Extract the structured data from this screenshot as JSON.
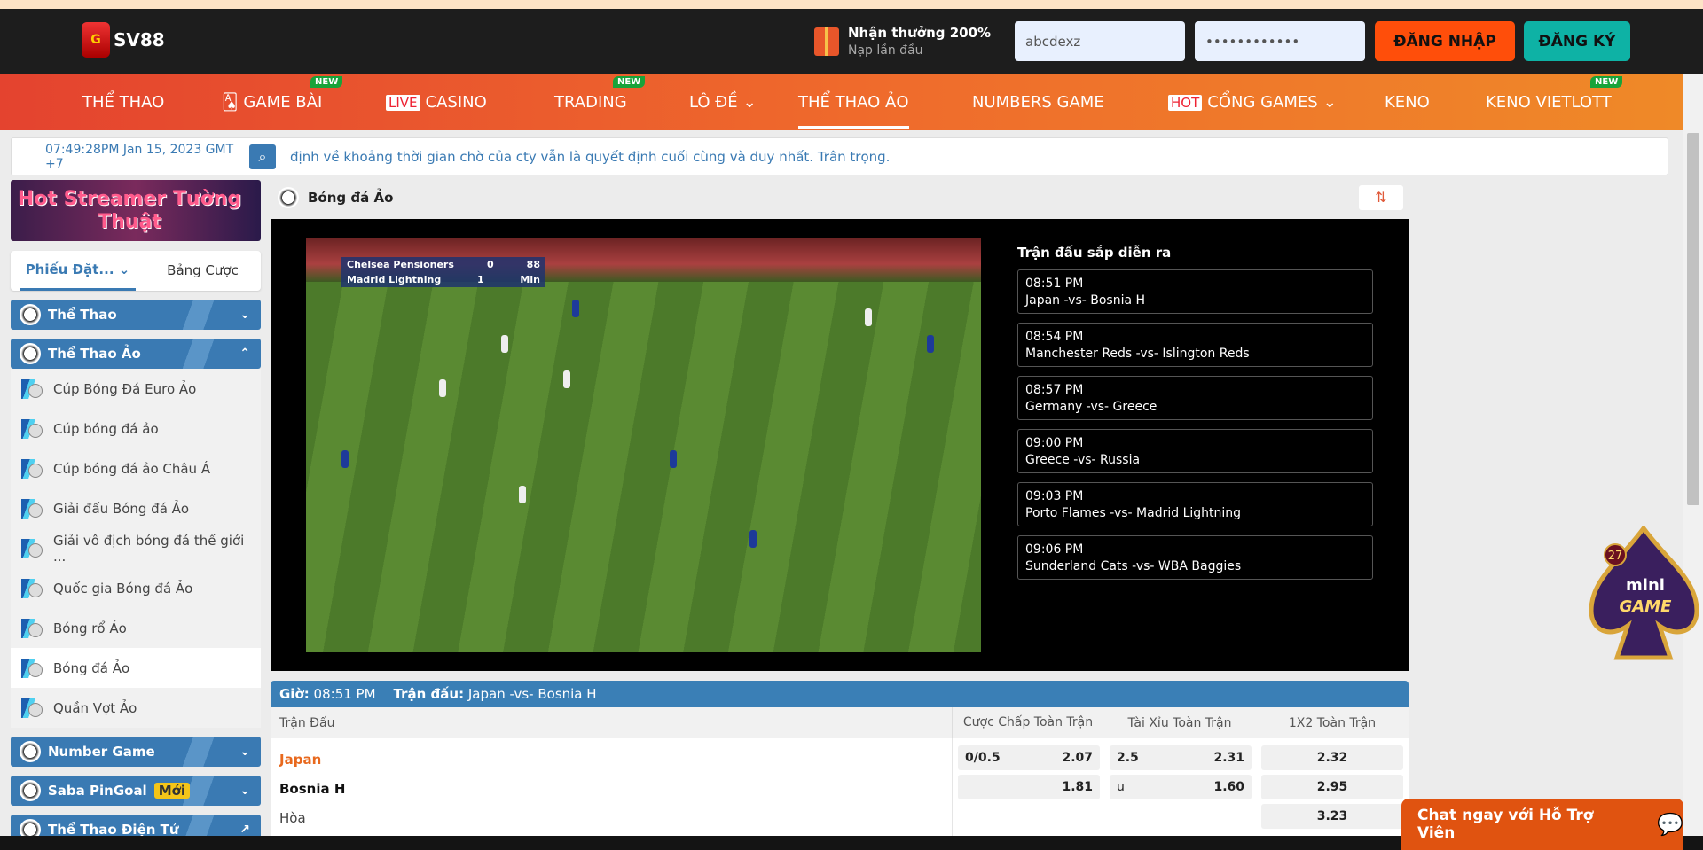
{
  "header": {
    "logo_text": "SV88",
    "promo_title": "Nhận thưởng 200%",
    "promo_sub": "Nạp lần đầu",
    "username_value": "abcdexz",
    "password_value": "••••••••••••",
    "login_label": "ĐĂNG NHẬP",
    "register_label": "ĐĂNG KÝ",
    "colors": {
      "login": "#ff4e0a",
      "register": "#0eb2a5"
    }
  },
  "nav": {
    "items": [
      {
        "label": "THỂ THAO"
      },
      {
        "label": "GAME BÀI",
        "new": "NEW"
      },
      {
        "label": "CASINO",
        "badge": "LIVE"
      },
      {
        "label": "TRADING",
        "new": "NEW"
      },
      {
        "label": "LÔ ĐỀ"
      },
      {
        "label": "THỂ THAO ẢO"
      },
      {
        "label": "NUMBERS GAME"
      },
      {
        "label": "CỔNG GAMES",
        "badge": "HOT"
      },
      {
        "label": "KENO"
      },
      {
        "label": "KENO VIETLOTT",
        "new": "NEW"
      }
    ]
  },
  "marquee": {
    "datetime": "07:49:28PM Jan 15, 2023 GMT +7",
    "message": "định về khoảng thời gian chờ của cty vẫn là quyết định cuối cùng và duy nhất. Trân trọng."
  },
  "sidebar": {
    "banner_text": "Hot Streamer Tường Thuật",
    "tabs": [
      "Phiếu Đặt...",
      "Bảng Cược"
    ],
    "sections": [
      "Thể Thao",
      "Thể Thao Ảo",
      "Number Game",
      "Saba PinGoal",
      "Thể Thao Điện Tử"
    ],
    "saba_badge": "Mới",
    "items": [
      "Cúp Bóng Đá Euro Ảo",
      "Cúp bóng đá ảo",
      "Cúp bóng đá ảo Châu Á",
      "Giải đấu Bóng đá Ảo",
      "Giải vô địch bóng đá thế giới ...",
      "Quốc gia Bóng đá Ảo",
      "Bóng rổ Ảo",
      "Bóng đá Ảo",
      "Quần Vợt Ảo"
    ]
  },
  "main": {
    "title": "Bóng đá Ảo",
    "video": {
      "home": "Chelsea Pensioners",
      "away": "Madrid Lightning",
      "home_score": "0",
      "away_score": "1",
      "clock": "88",
      "clock_unit": "Min"
    },
    "upcoming_title": "Trận đấu sắp diễn ra",
    "upcoming": [
      {
        "time": "08:51 PM",
        "match": "Japan -vs- Bosnia H"
      },
      {
        "time": "08:54 PM",
        "match": "Manchester Reds -vs- Islington Reds"
      },
      {
        "time": "08:57 PM",
        "match": "Germany -vs- Greece"
      },
      {
        "time": "09:00 PM",
        "match": "Greece -vs- Russia"
      },
      {
        "time": "09:03 PM",
        "match": "Porto Flames -vs- Madrid Lightning"
      },
      {
        "time": "09:06 PM",
        "match": "Sunderland Cats -vs- WBA Baggies"
      }
    ],
    "match_header": {
      "time_label": "Giờ:",
      "time": "08:51 PM",
      "match_label": "Trận đấu:",
      "match": "Japan -vs- Bosnia H"
    },
    "columns": [
      "Trận Đấu",
      "Cược Chấp Toàn Trận",
      "Tài Xỉu Toàn Trận",
      "1X2 Toàn Trận"
    ],
    "rows": [
      {
        "team": "Japan",
        "hdp_line": "0/0.5",
        "hdp": "2.07",
        "ou_line": "2.5",
        "ou": "2.31",
        "x12": "2.32"
      },
      {
        "team": "Bosnia H",
        "hdp_line": "",
        "hdp": "1.81",
        "ou_line": "u",
        "ou": "1.60",
        "x12": "2.95"
      },
      {
        "team": "Hòa",
        "x12": "3.23"
      }
    ]
  },
  "chat": {
    "label": "Chat ngay với Hỗ Trợ Viên"
  },
  "mini_game": {
    "count": "27",
    "label1": "mini",
    "label2": "GAME"
  }
}
